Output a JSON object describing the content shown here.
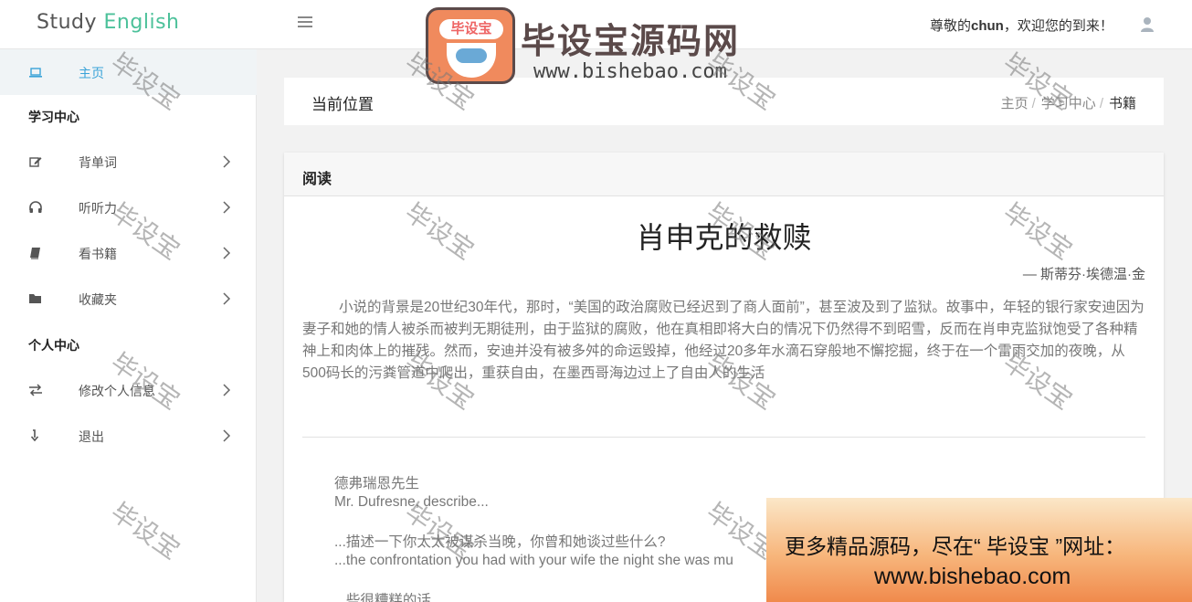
{
  "header": {
    "logo_word1": "Study",
    "logo_word2": "English",
    "welcome_prefix": "尊敬的",
    "welcome_user": "chun",
    "welcome_suffix": "，欢迎您的到来！"
  },
  "sidebar": {
    "home_label": "主页",
    "section_study": "学习中心",
    "items": [
      {
        "label": "背单词",
        "icon": "edit-icon"
      },
      {
        "label": "听听力",
        "icon": "headphones-icon"
      },
      {
        "label": "看书籍",
        "icon": "book-icon"
      },
      {
        "label": "收藏夹",
        "icon": "folder-icon"
      }
    ],
    "section_personal": "个人中心",
    "personal_items": [
      {
        "label": "修改个人信息",
        "icon": "exchange-icon"
      },
      {
        "label": "退出",
        "icon": "logout-icon"
      }
    ]
  },
  "breadcrumb": {
    "title": "当前位置",
    "items": [
      "主页",
      "学习中心",
      "书籍"
    ],
    "separator": "/"
  },
  "reading": {
    "panel_title": "阅读",
    "book_title": "肖申克的救赎",
    "author": "— 斯蒂芬·埃德温·金",
    "intro": "小说的背景是20世纪30年代，那时，“美国的政治腐败已经迟到了商人面前”，甚至波及到了监狱。故事中，年轻的银行家安迪因为妻子和她的情人被杀而被判无期徒刑，由于监狱的腐败，他在真相即将大白的情况下仍然得不到昭雪，反而在肖申克监狱饱受了各种精神上和肉体上的摧残。然而，安迪并没有被多舛的命运毁掉，他经过20多年水滴石穿般地不懈挖掘，终于在一个雷雨交加的夜晚，从500码长的污粪管道中爬出，重获自由，在墨西哥海边过上了自由人的生活",
    "dialogue": [
      "德弗瑞恩先生",
      "Mr. Dufresne, describe...",
      "...描述一下你太太被谋杀当晚，你曾和她谈过些什么?",
      "...the confrontation you had with your wife the night she was mu",
      "...些很糟糕的话"
    ]
  },
  "watermark": {
    "text": "毕设宝",
    "logo_badge": "毕设宝",
    "logo_title": "毕设宝源码网",
    "logo_url": "www.bishebao.com"
  },
  "promo": {
    "line1": "更多精品源码，尽在“ 毕设宝 ”网址：",
    "line2": "www.bishebao.com"
  },
  "colors": {
    "accent": "#3aa3d8",
    "logo_green": "#4cc19a",
    "promo_orange": "#f08a4c"
  }
}
